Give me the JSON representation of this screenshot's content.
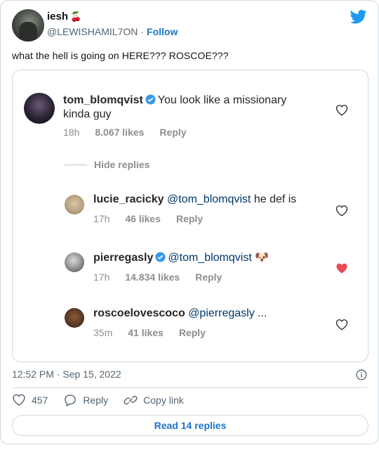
{
  "author": {
    "display_name": "iesh",
    "name_emoji": "🍒",
    "handle": "@LEWISHAMIL7ON",
    "separator": "·",
    "follow_label": "Follow"
  },
  "tweet_text": "what the hell is going on HERE??? ROSCOE???",
  "embed": {
    "top_comment": {
      "username": "tom_blomqvist",
      "text_line1": "You look like a missionary",
      "text_line2": "kinda guy",
      "time": "18h",
      "likes": "8.067 likes",
      "reply_label": "Reply"
    },
    "hide_replies_label": "Hide replies",
    "replies": [
      {
        "username": "lucie_racicky",
        "mention": "@tom_blomqvist",
        "text": " he def is",
        "time": "17h",
        "likes": "46 likes",
        "reply_label": "Reply"
      },
      {
        "username": "pierregasly",
        "mention": "@tom_blomqvist",
        "text": " 🐶",
        "time": "17h",
        "likes": "14.834 likes",
        "reply_label": "Reply",
        "liked": true
      },
      {
        "username": "roscoelovescoco",
        "mention": "@pierregasly",
        "text": " ...",
        "time": "35m",
        "likes": "41 likes",
        "reply_label": "Reply"
      }
    ]
  },
  "footer": {
    "timestamp": "12:52 PM · Sep 15, 2022",
    "like_count": "457",
    "reply_label": "Reply",
    "copy_link_label": "Copy link",
    "read_replies_label": "Read 14 replies"
  },
  "colors": {
    "twitter_blue": "#1d9bf0",
    "link_blue": "#1d74c9",
    "liked_red": "#ed4956",
    "verified_blue": "#3897f0"
  },
  "icons": [
    "twitter-bird-icon",
    "verified-badge-icon",
    "heart-icon",
    "info-icon",
    "reply-icon",
    "link-icon"
  ]
}
